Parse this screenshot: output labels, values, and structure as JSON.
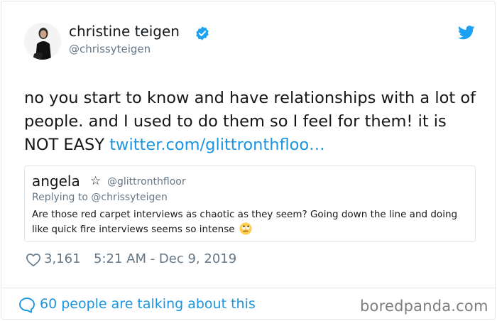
{
  "author": {
    "name": "christine teigen",
    "handle": "@chrissyteigen",
    "verified": true
  },
  "tweet": {
    "text": "no you start to know and have relationships with a lot of people. and I used to do them so I feel for them! it is NOT EASY ",
    "link": "twitter.com/glittronthfloo…"
  },
  "quoted_tweet": {
    "name": "angela",
    "star": "☆",
    "handle": "@glittronthfloor",
    "replying_to": "Replying to @chrissyteigen",
    "text": "Are those red carpet interviews as chaotic as they seem? Going down the line and doing like quick fire interviews seems so intense "
  },
  "stats": {
    "likes": "3,161",
    "timestamp": "5:21 AM - Dec 9, 2019"
  },
  "footer": {
    "talking": "60 people are talking about this"
  },
  "watermark": "boredpanda.com",
  "colors": {
    "twitter_blue": "#1b95e0",
    "verified_blue": "#1da1f2",
    "muted": "#657786",
    "text": "#14171a",
    "border": "#e1e8ed"
  },
  "icons": [
    "avatar",
    "verified-badge-icon",
    "twitter-bird-icon",
    "rolling-eyes-emoji",
    "heart-icon",
    "speech-bubble-icon"
  ]
}
